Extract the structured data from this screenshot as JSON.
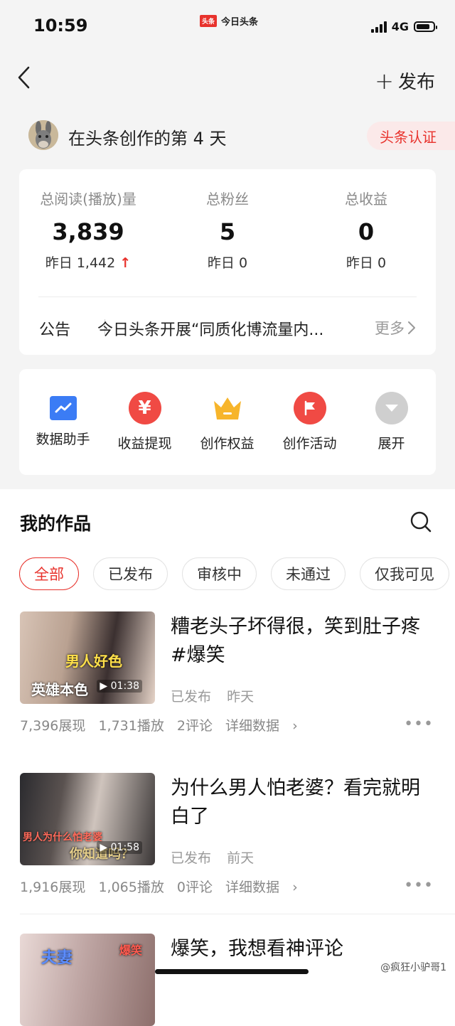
{
  "status_bar": {
    "time": "10:59",
    "app_logo": "头条",
    "app_name": "今日头条",
    "network": "4G"
  },
  "nav": {
    "publish_label": "发布"
  },
  "profile": {
    "days_text": "在头条创作的第 4 天",
    "badge": "头条认证"
  },
  "stats": [
    {
      "label": "总阅读(播放)量",
      "value": "3,839",
      "yesterday": "昨日 1,442",
      "trend": "↑"
    },
    {
      "label": "总粉丝",
      "value": "5",
      "yesterday": "昨日 0",
      "trend": ""
    },
    {
      "label": "总收益",
      "value": "0",
      "yesterday": "昨日 0",
      "trend": ""
    }
  ],
  "notice": {
    "label": "公告",
    "text": "今日头条开展“同质化博流量内...",
    "more": "更多"
  },
  "tools": [
    {
      "label": "数据助手",
      "icon": "chart-icon",
      "color": "#3b7cf5"
    },
    {
      "label": "收益提现",
      "icon": "yuan-icon",
      "color": "#f04a44"
    },
    {
      "label": "创作权益",
      "icon": "crown-icon",
      "color": "#f7b52b"
    },
    {
      "label": "创作活动",
      "icon": "flag-icon",
      "color": "#f04a44"
    },
    {
      "label": "展开",
      "icon": "expand-icon",
      "color": "#cfcfcf"
    }
  ],
  "works": {
    "title": "我的作品",
    "filters": [
      "全部",
      "已发布",
      "审核中",
      "未通过",
      "仅我可见"
    ],
    "items": [
      {
        "title": "糟老头子坏得很，笑到肚子疼#爆笑",
        "status": "已发布",
        "time": "昨天",
        "duration": "01:38",
        "thumb_text_1": "男人好色",
        "thumb_text_2": "英雄本色",
        "views": "7,396展现",
        "plays": "1,731播放",
        "comments": "2评论",
        "detail": "详细数据"
      },
      {
        "title": "为什么男人怕老婆？看完就明白了",
        "status": "已发布",
        "time": "前天",
        "duration": "01:58",
        "thumb_text_1": "男人为什么怕老婆",
        "thumb_text_2": "你知道吗？",
        "views": "1,916展现",
        "plays": "1,065播放",
        "comments": "0评论",
        "detail": "详细数据"
      },
      {
        "title": "爆笑，我想看神评论",
        "thumb_text_1": "夫妻",
        "thumb_text_2": "爆笑"
      }
    ]
  },
  "watermark": "@疯狂小驴哥1"
}
